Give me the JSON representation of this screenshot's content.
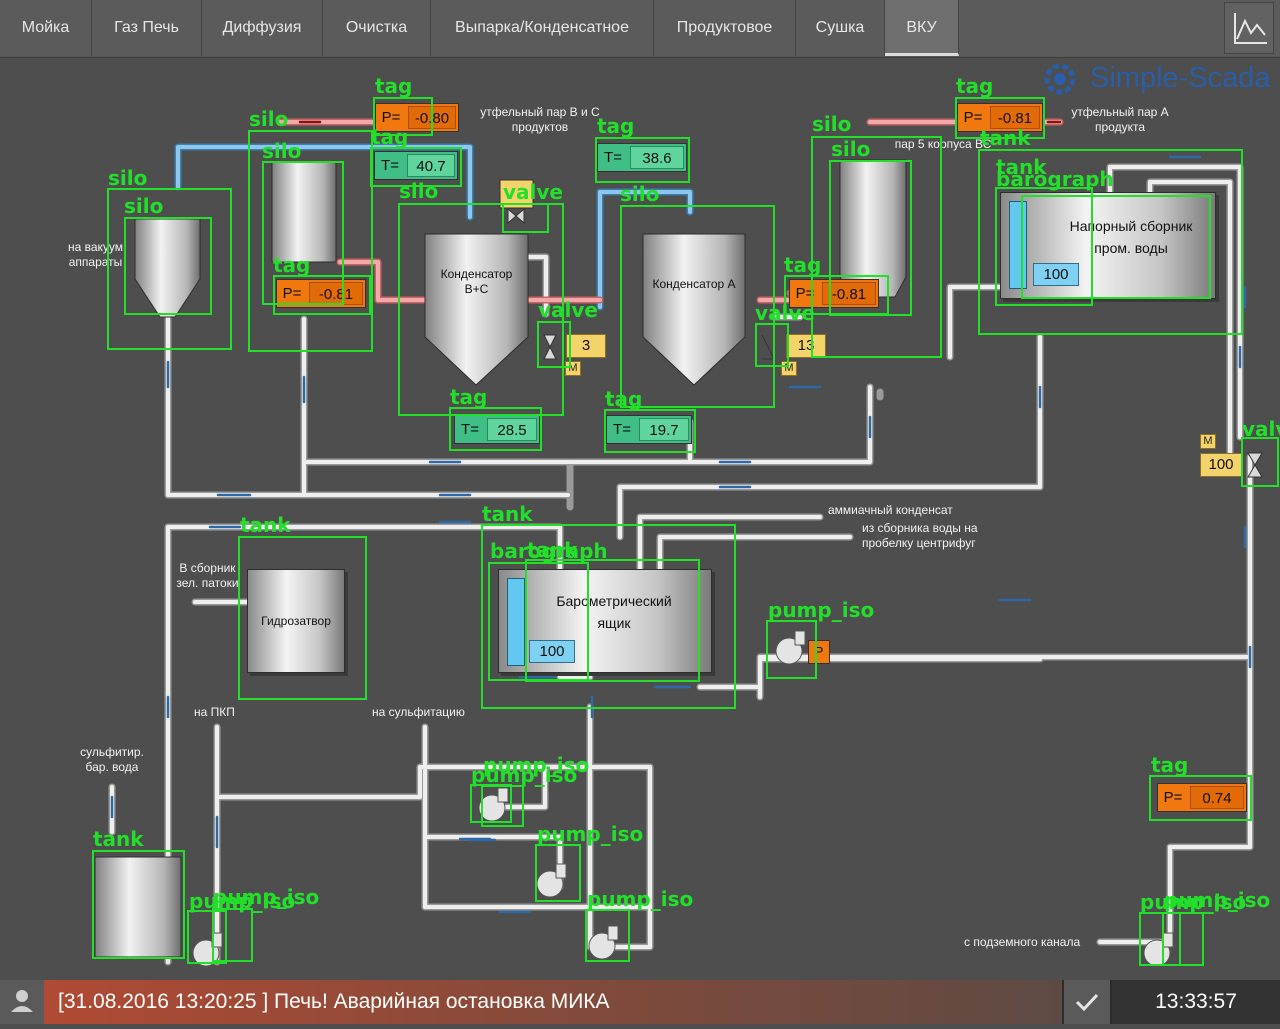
{
  "tabs": [
    "Мойка",
    "Газ Печь",
    "Диффузия",
    "Очистка",
    "Выпарка/Конденсатное",
    "Продуктовое",
    "Сушка",
    "ВКУ"
  ],
  "active_tab": "ВКУ",
  "logo": {
    "text": "Simple-Scada",
    "color": "#2a5ea8"
  },
  "labels": {
    "vacuum": "на вакуум\nаппараты",
    "steam_bc": "утфельный пар В и С\nпродуктов",
    "steam_a": "утфельный пар А\nпродукта",
    "steam_5": "пар 5 корпуса ВС",
    "ammonia": "аммиачный конденсат",
    "from_water": "из сборника воды на\nпробелку центрифуг",
    "green_molasses": "В сборник\nзел. патоки",
    "to_pkp": "на ПКП",
    "to_sulf": "на сульфитацию",
    "sulf_water": "сульфитир.\nбар. вода",
    "underground": "с подземного канала"
  },
  "equipment": {
    "condenser_bc": "Конденсатор\nВ+С",
    "condenser_a": "Конденсатор А",
    "pressure_tank": "Напорный сборник\nпром. воды",
    "pressure_tank_level": "100",
    "barometric": "Барометрический\nящик",
    "barometric_level": "100",
    "hydro": "Гидрозатвор"
  },
  "tags": {
    "p1": {
      "k": "P=",
      "v": "-0.80"
    },
    "t1": {
      "k": "T=",
      "v": "40.7"
    },
    "t2": {
      "k": "T=",
      "v": "38.6"
    },
    "p2": {
      "k": "P=",
      "v": "-0.81"
    },
    "p3": {
      "k": "P=",
      "v": "-0.81"
    },
    "p4": {
      "k": "P=",
      "v": "-0.81"
    },
    "t3": {
      "k": "T=",
      "v": "28.5"
    },
    "t4": {
      "k": "T=",
      "v": "19.7"
    },
    "p5": {
      "k": "P=",
      "v": "0.74"
    }
  },
  "valves": {
    "v1": "3",
    "v2": "13",
    "v3": "100",
    "m": "M"
  },
  "pump_mode": "P",
  "overlay": {
    "tag": "tag",
    "silo": "silo",
    "valve": "valve",
    "tank": "tank",
    "barograph": "barograph",
    "pump_iso": "pump_iso"
  },
  "status": {
    "alarm": "[31.08.2016  13:20:25 ]  Печь! Аварийная остановка МИКА",
    "clock": "13:33:57"
  }
}
